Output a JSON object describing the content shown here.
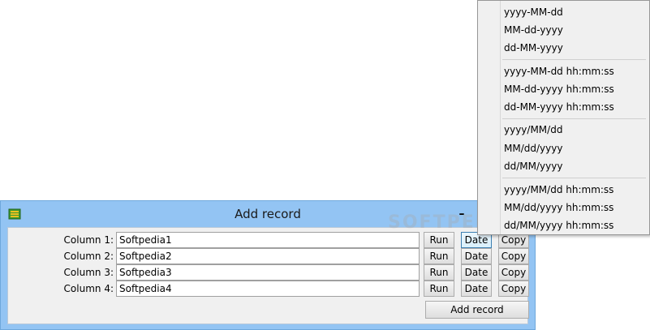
{
  "window": {
    "title": "Add record",
    "minimize_label": "–"
  },
  "rows": [
    {
      "label": "Column 1:",
      "value": "Softpedia1"
    },
    {
      "label": "Column 2:",
      "value": "Softpedia2"
    },
    {
      "label": "Column 3:",
      "value": "Softpedia3"
    },
    {
      "label": "Column 4:",
      "value": "Softpedia4"
    }
  ],
  "buttons": {
    "run": "Run",
    "date": "Date",
    "copy": "Copy",
    "add_record": "Add record"
  },
  "menu": {
    "groups": [
      [
        "yyyy-MM-dd",
        "MM-dd-yyyy",
        "dd-MM-yyyy"
      ],
      [
        "yyyy-MM-dd hh:mm:ss",
        "MM-dd-yyyy hh:mm:ss",
        "dd-MM-yyyy hh:mm:ss"
      ],
      [
        "yyyy/MM/dd",
        "MM/dd/yyyy",
        "dd/MM/yyyy"
      ],
      [
        "yyyy/MM/dd hh:mm:ss",
        "MM/dd/yyyy hh:mm:ss",
        "dd/MM/yyyy hh:mm:ss"
      ]
    ]
  },
  "watermark": "SOFTPEDIA",
  "colors": {
    "titlebar": "#93c4f3",
    "client": "#f0f0f0",
    "menu_bg": "#f0f0f0"
  },
  "icons": {
    "app": "database-icon"
  }
}
